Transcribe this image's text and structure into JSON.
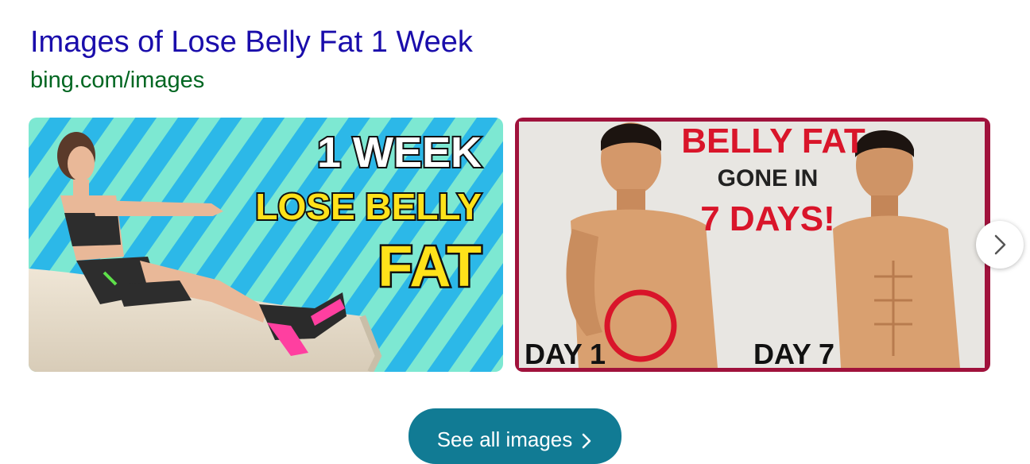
{
  "result": {
    "title": "Images of Lose Belly Fat 1 Week",
    "url": "bing.com/images"
  },
  "images": [
    {
      "lines": [
        "1 WEEK",
        "LOSE BELLY",
        "FAT"
      ],
      "colors": {
        "stripe_a": "#2cb8e8",
        "stripe_b": "#7de8d2",
        "headline": "#ffffff",
        "accent": "#ffe21a"
      }
    },
    {
      "lines": [
        "BELLY FAT",
        "GONE IN",
        "7 DAYS!",
        "DAY 1",
        "DAY 7"
      ],
      "colors": {
        "frame": "#a0123c",
        "background": "#e8e6e2",
        "red": "#d9152a",
        "skin": "#d9a070"
      }
    }
  ],
  "controls": {
    "next_icon": "chevron-right-icon",
    "see_all_label": "See all images",
    "see_all_icon": "chevron-right-icon"
  },
  "colors": {
    "title": "#1a0dab",
    "url": "#006621",
    "button": "#117b94"
  }
}
